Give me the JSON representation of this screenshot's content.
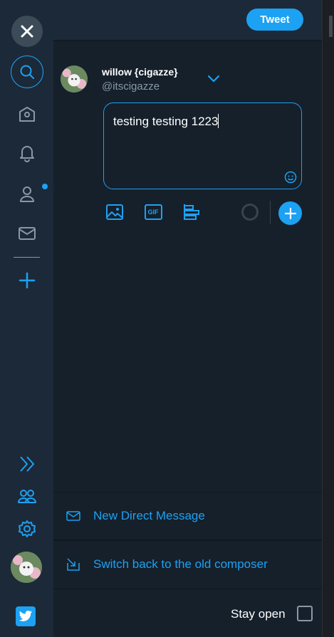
{
  "colors": {
    "accent": "#1da1f2",
    "background": "#15202b",
    "rail": "#1c2938",
    "muted": "#8899a6"
  },
  "nav": {
    "items": [
      {
        "name": "close-icon"
      },
      {
        "name": "search-icon"
      },
      {
        "name": "home-icon"
      },
      {
        "name": "notifications-icon"
      },
      {
        "name": "profile-icon"
      },
      {
        "name": "messages-icon"
      },
      {
        "name": "add-column-icon"
      },
      {
        "name": "expand-icon"
      },
      {
        "name": "accounts-icon"
      },
      {
        "name": "settings-icon"
      },
      {
        "name": "twitter-bird-icon"
      }
    ]
  },
  "header": {
    "tweet_label": "Tweet"
  },
  "account": {
    "name": "willow {cigazze}",
    "handle": "@itscigazze"
  },
  "composer": {
    "text": "testing testing 1223"
  },
  "footer": {
    "new_dm_label": "New Direct Message",
    "switch_label": "Switch back to the old composer",
    "stay_open_label": "Stay open",
    "stay_open_checked": false
  }
}
